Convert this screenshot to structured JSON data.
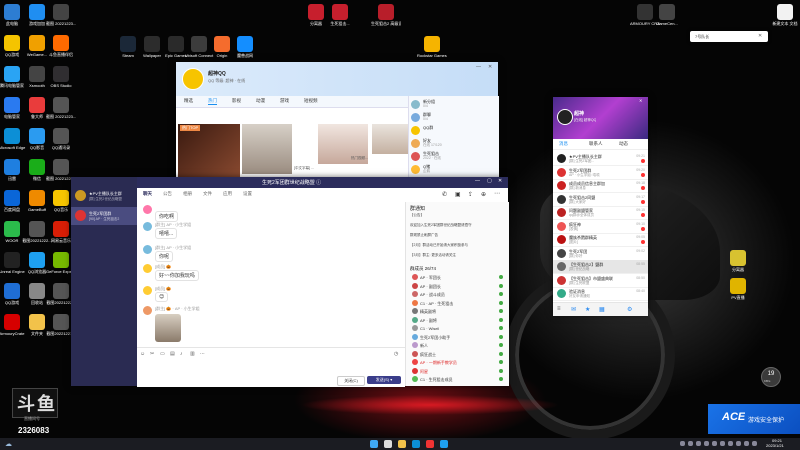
{
  "colors": {
    "accent": "#2b2c5c",
    "qq_blue": "#1a8ff0",
    "badge_red": "#f03c3c",
    "tray_banner": "#1a73e8"
  },
  "desktop": {
    "left_icons": [
      {
        "label": "此电脑",
        "icon": "computer-icon",
        "color": "#2d7dd2"
      },
      {
        "label": "游戏加加",
        "icon": "game-plus-icon",
        "color": "#1f8ef1"
      },
      {
        "label": "截图\n20221223...",
        "icon": "screenshot-icon",
        "color": "#444"
      },
      {
        "label": "QQ游戏",
        "icon": "qq-game-icon",
        "color": "#f5c400"
      },
      {
        "label": "WeGame...",
        "icon": "wegame-icon",
        "color": "#f0a000"
      },
      {
        "label": "斗鱼直播伴侣",
        "icon": "douyu-icon",
        "color": "#ff6a00"
      },
      {
        "label": "腾讯电脑管家",
        "icon": "tencent-manager-icon",
        "color": "#2aa4f4"
      },
      {
        "label": "Xsmooth",
        "icon": "xsmooth-icon",
        "color": "#444"
      },
      {
        "label": "OBS Studio",
        "icon": "obs-icon",
        "color": "#302e31"
      },
      {
        "label": "电脑管家",
        "icon": "pc-manager-icon",
        "color": "#2a7af0"
      },
      {
        "label": "鲁大师",
        "icon": "ludashi-icon",
        "color": "#e93c3c"
      },
      {
        "label": "截图\n20221223...",
        "icon": "screenshot-icon",
        "color": "#555"
      },
      {
        "label": "Microsoft Edge",
        "icon": "edge-icon",
        "color": "#0c8fd6"
      },
      {
        "label": "QQ影音",
        "icon": "qq-player-icon",
        "color": "#2b9bf0"
      },
      {
        "label": "QQ通讯录",
        "icon": "qq-contacts-icon",
        "color": "#555"
      },
      {
        "label": "迅雷",
        "icon": "thunder-icon",
        "color": "#1f7fe0"
      },
      {
        "label": "微信",
        "icon": "wechat-icon",
        "color": "#1aad19"
      },
      {
        "label": "截图\n20221223...",
        "icon": "screenshot-icon",
        "color": "#555"
      },
      {
        "label": "百度网盘",
        "icon": "baidu-pan-icon",
        "color": "#0a66d8"
      },
      {
        "label": "GameBuff",
        "icon": "gamebuff-icon",
        "color": "#ef8a00"
      },
      {
        "label": "QQ音乐",
        "icon": "qq-music-icon",
        "color": "#f7c600"
      },
      {
        "label": "WOOR",
        "icon": "woor-icon",
        "color": "#2bbb4b"
      },
      {
        "label": "截图20221222...",
        "icon": "screenshot-icon",
        "color": "#555"
      },
      {
        "label": "网易云音乐",
        "icon": "netease-music-icon",
        "color": "#d81e06"
      },
      {
        "label": "Unreal Engine",
        "icon": "unreal-icon",
        "color": "#222"
      },
      {
        "label": "QQ浏览器",
        "icon": "qq-browser-icon",
        "color": "#1ea0f0"
      },
      {
        "label": "GeForce Experience",
        "icon": "geforce-icon",
        "color": "#76b900"
      },
      {
        "label": "QQ游戏",
        "icon": "qq-game-icon",
        "color": "#1f6ed4"
      },
      {
        "label": "回收站",
        "icon": "recycle-bin-icon",
        "color": "#888"
      },
      {
        "label": "截图20221222...",
        "icon": "screenshot-icon",
        "color": "#555"
      },
      {
        "label": "ArmouryCrate",
        "icon": "armoury-icon",
        "color": "#d60000"
      },
      {
        "label": "文件夹",
        "icon": "folder-icon",
        "color": "#f2c24a"
      },
      {
        "label": "截图20221221...",
        "icon": "screenshot-icon",
        "color": "#555"
      }
    ],
    "top_icons": [
      {
        "label": "Steam",
        "icon": "steam-icon",
        "color": "#1b2838"
      },
      {
        "label": "Wallpaper",
        "icon": "wallpaper-icon",
        "color": "#2c2c2c"
      },
      {
        "label": "Epic\nGames",
        "icon": "epic-icon",
        "color": "#2a2a2a"
      },
      {
        "label": "Ubisoft\nConnect",
        "icon": "ubisoft-icon",
        "color": "#3c3c3c"
      },
      {
        "label": "Origin",
        "icon": "origin-icon",
        "color": "#f56c2d"
      },
      {
        "label": "魔兽战网",
        "icon": "battlenet-icon",
        "color": "#148eff"
      },
      {
        "label": "分离器",
        "icon": "separator-icon",
        "color": "#c71f2d"
      },
      {
        "label": "生死狙击...",
        "icon": "game-icon",
        "color": "#c71f2d"
      },
      {
        "label": "生死狙击2\n高级设置",
        "icon": "game-settings-icon",
        "color": "#b81e2a"
      },
      {
        "label": "Rockstar\nGames...",
        "icon": "rockstar-icon",
        "color": "#f6b400"
      },
      {
        "label": "ARMOURY\nCRATE",
        "icon": "armoury-crate-icon",
        "color": "#333"
      },
      {
        "label": "GameCen...",
        "icon": "gamecenter-icon",
        "color": "#444"
      },
      {
        "label": "新建文本\n文档",
        "icon": "text-doc-icon",
        "color": "#f2f2f2"
      }
    ],
    "right_icons": [
      {
        "label": "分离器",
        "icon": "separator-icon",
        "color": "#d8c230"
      },
      {
        "label": "PV直播",
        "icon": "pv-live-icon",
        "color": "#e0b400"
      }
    ]
  },
  "search_popup": {
    "text": "7号队长"
  },
  "qq_main": {
    "title": "超神QQ",
    "subtitle": "QQ  等级: 超神 · 在线",
    "tabs": [
      "精选",
      "热门",
      "影视",
      "动漫",
      "游戏",
      "短视频"
    ],
    "active_tab": "热门",
    "banner_label": "热门TOP",
    "thumb_captions": [
      "",
      "[中文字幕] ...",
      "热门视频..."
    ],
    "right_panel": [
      {
        "title": "新分组",
        "sub": "0/4"
      },
      {
        "title": "群聊",
        "sub": "0/4"
      },
      {
        "title": "QQ群",
        "sub": ""
      },
      {
        "title": "好友",
        "sub": "在线 17/120"
      },
      {
        "title": "生死狙击",
        "sub": "2022 · 在线"
      },
      {
        "title": "Q猪",
        "sub": "企鹅"
      }
    ]
  },
  "chat": {
    "title": "生死2军团群世纪战略盟 ⓘ",
    "sidebar_item": "★PV主播队长主群",
    "sidebar_sub": "[群] 生死2世纪战略盟",
    "sidebar_item2": "生死2军团群",
    "sidebar_sub2": "[90] AP · 生死狙击2",
    "tabs": [
      "聊天",
      "公告",
      "相册",
      "文件",
      "应用",
      "设置"
    ],
    "messages": [
      {
        "name": "",
        "text": "你吃啊"
      },
      {
        "name": "[群主] AP · 小生学姐",
        "text": "嘻嘻..."
      },
      {
        "name": "[群主] AP · 小生学姐",
        "text": "你呢"
      },
      {
        "name": "[成员] 🎃",
        "text": "好~~你加我玩吗"
      },
      {
        "name": "[成员] 🎃",
        "text": "😊"
      },
      {
        "name": "[群主] 🎃 · AP · 小生学姐",
        "text": ""
      }
    ],
    "notice_title": "群通知",
    "notice_lines": [
      "【公告】",
      "欢迎加入生死2军团群世纪战略盟请遵守",
      "群规禁止刷屏广告",
      "【2月】群活动已开始请大家积极参与",
      "【3月】群主: 更多活动请关注"
    ],
    "members_title": "群成员 26/74",
    "members": [
      "AP · 军团长",
      "AP · 副团长",
      "AP · 战斗成员",
      "C1 · AP · 生死狙击",
      "精英副将",
      "AP · 副将",
      "C1 · Wisell",
      "生死2军团小助手",
      "新人",
      "疯狂战士",
      "AP · 一期新手教学员",
      "阿星",
      "C1 · 生死狙击成员"
    ],
    "input_placeholder": "",
    "close_label": "关闭(C)",
    "send_label": "发送(S) ▾"
  },
  "qq_friends": {
    "name": "超神",
    "status": "[在线] 超神QQ",
    "tabs": [
      "消息",
      "联系人",
      "动态"
    ],
    "items": [
      {
        "name": "★PV主播队长主群",
        "sub": "[群] 生死2军团...",
        "time": "09:21"
      },
      {
        "name": "生死2军团群",
        "sub": "AP · 小生学姐: 嘻嘻",
        "time": "09:20"
      },
      {
        "name": "成员成员信息主群加",
        "sub": "[群] 新消息",
        "time": "09:18"
      },
      {
        "name": "生死狙击2同盟",
        "sub": "[群] 大家好",
        "time": "09:17"
      },
      {
        "name": "问题副盟管家",
        "sub": "qq群@全体成员",
        "time": "09:15"
      },
      {
        "name": "疯狂神",
        "sub": "[表情]",
        "time": "09:10"
      },
      {
        "name": "魔族杀戮群精英",
        "sub": "[图片]",
        "time": "09:05"
      },
      {
        "name": "生死2军团",
        "sub": "[群] 你好",
        "time": "09:02"
      },
      {
        "name": "【生死狙击2】盟群",
        "sub": "[群] 世纪战略",
        "time": "08:55"
      },
      {
        "name": "【生死狙击】市盟盛典联",
        "sub": "[群] 生死联盟",
        "time": "08:50"
      },
      {
        "name": "验证消息",
        "sub": "好友申请通知",
        "time": "08:40"
      }
    ]
  },
  "overlay": {
    "douyu_brand": "斗鱼",
    "douyu_sub": "直播间号",
    "room_id": "2326083",
    "speed": "19",
    "speed_unit": "KB/s",
    "ace_label": "游戏安全保护",
    "ace_brand": "ACE"
  },
  "taskbar": {
    "time": "09:21",
    "date": "2023/1/21"
  }
}
